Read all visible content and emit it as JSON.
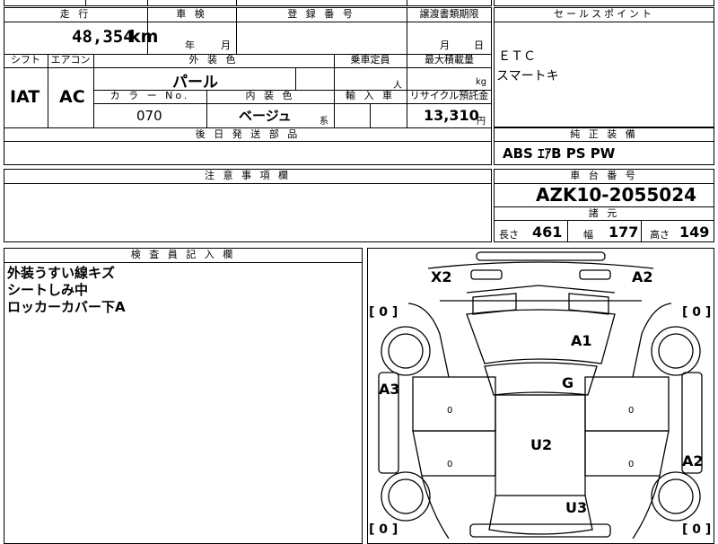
{
  "top_strip": {
    "partial_text": ""
  },
  "row1": {
    "mileage_header": "走 行",
    "mileage_value": "48,354",
    "mileage_unit": "km",
    "inspection_header": "車 検",
    "inspection_year": "年",
    "inspection_month": "月",
    "registration_header": "登 録 番 号",
    "transfer_header": "譲渡書類期限",
    "transfer_month": "月",
    "transfer_day": "日"
  },
  "row2": {
    "shift_header": "シフト",
    "shift_value": "IAT",
    "ac_header": "エアコン",
    "ac_value": "AC",
    "exterior_color_header": "外 装 色",
    "exterior_color_value": "パール",
    "capacity_header": "乗車定員",
    "capacity_unit": "人",
    "max_load_header": "最大積載量",
    "max_load_unit": "kg",
    "color_no_header": "カ ラ ー No.",
    "color_no_value": "070",
    "interior_color_header": "内 装 色",
    "interior_color_value": "ベージュ",
    "interior_color_suffix": "系",
    "import_header": "輸 入 車",
    "recycle_header": "リサイクル預託金",
    "recycle_value": "13,310",
    "recycle_unit": "円"
  },
  "later_parts": {
    "header": "後 日 発 送 部 品",
    "value": ""
  },
  "notes": {
    "header": "注 意 事 項 欄",
    "value": ""
  },
  "sales_points": {
    "header": "セールスポイント",
    "lines": [
      "ＥＴＣ",
      "スマートキ"
    ]
  },
  "standard_equipment": {
    "header": "純 正 装 備",
    "value": "ABS ｴｱB PS PW"
  },
  "chassis": {
    "header": "車 台 番 号",
    "value": "AZK10-2055024"
  },
  "specs": {
    "header": "諸 元",
    "length_label": "長さ",
    "length_value": "461",
    "width_label": "幅",
    "width_value": "177",
    "height_label": "高さ",
    "height_value": "149"
  },
  "inspector": {
    "header": "検 査 員 記 入 欄",
    "lines": [
      "外装うすい線キズ",
      "シートしみ中",
      "ロッカーカバー下A"
    ]
  },
  "diagram": {
    "tire_tl": "[ 0 ]",
    "tire_tr": "[ 0 ]",
    "tire_bl": "[ 0 ]",
    "tire_br": "[ 0 ]",
    "marks": {
      "x2": "X2",
      "a2_top": "A2",
      "a1": "A1",
      "g": "G",
      "a3": "A3",
      "u2": "U2",
      "a2_right": "A2",
      "u3": "U3"
    },
    "panel_zeros": [
      "0",
      "0",
      "0",
      "0"
    ]
  }
}
